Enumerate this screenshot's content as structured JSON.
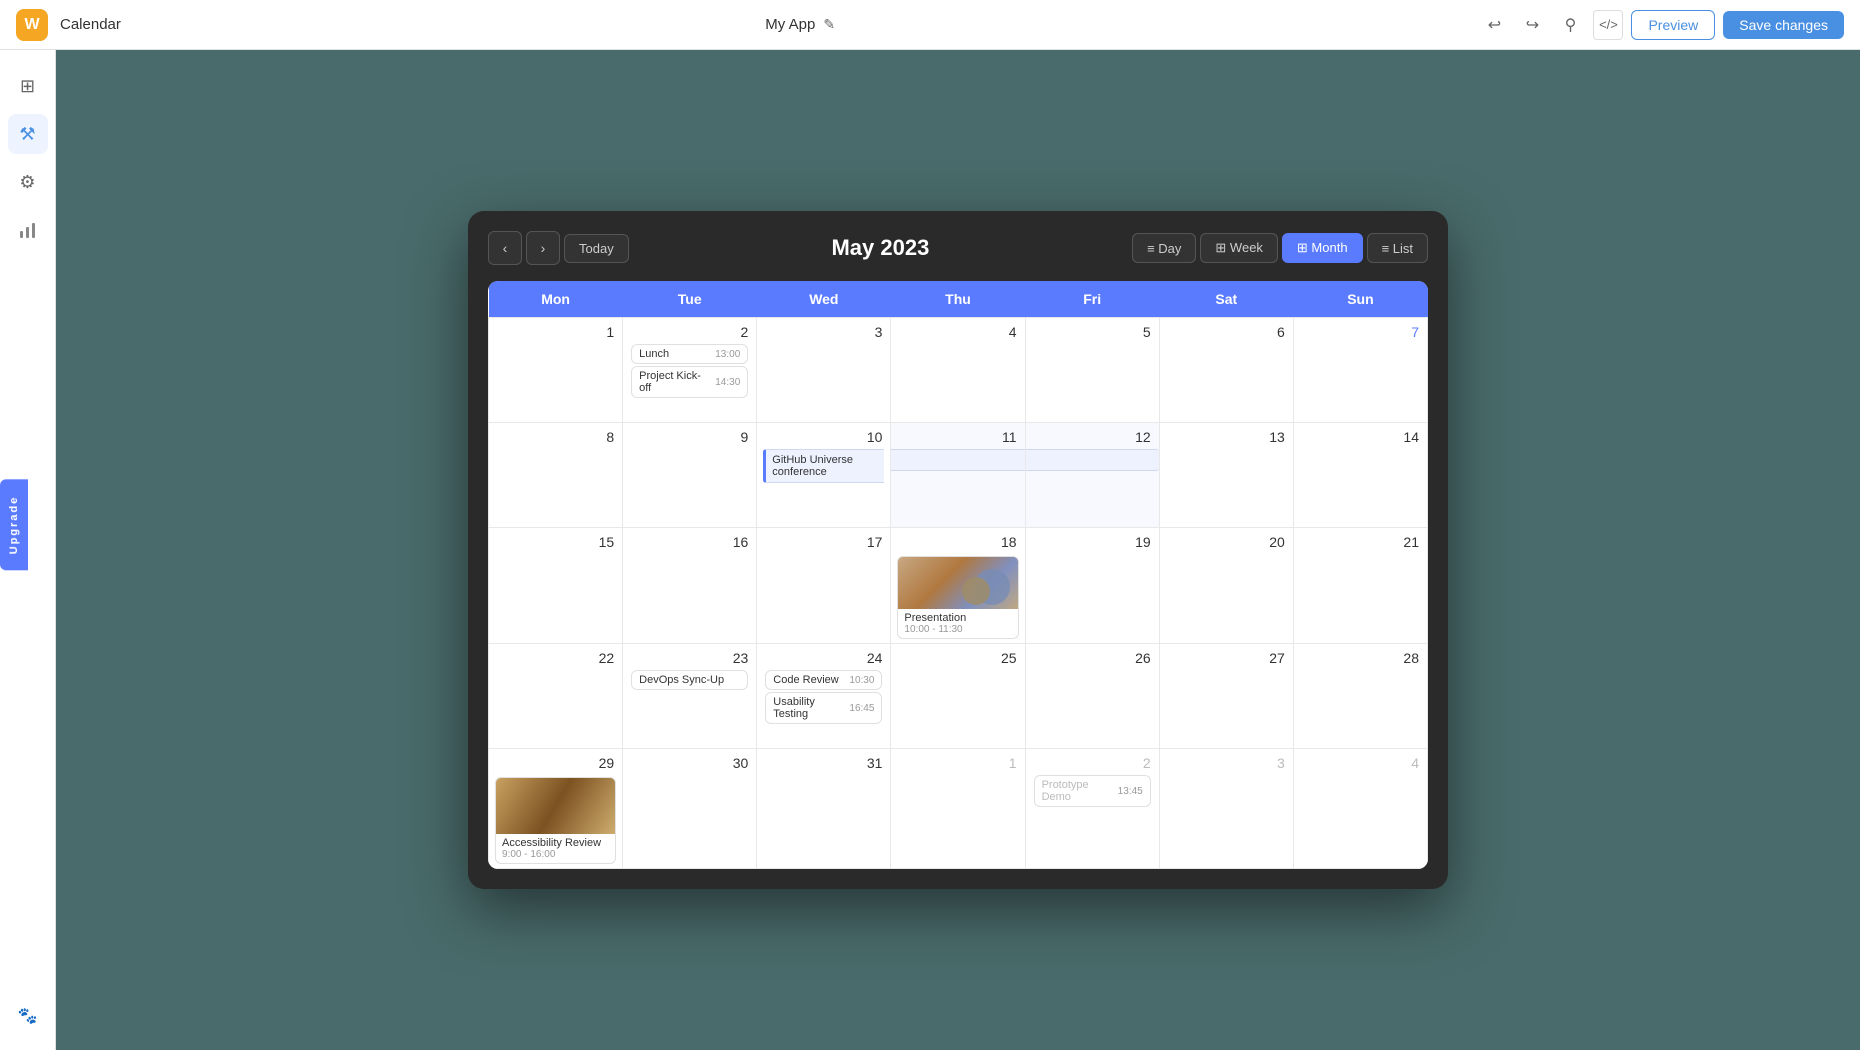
{
  "topbar": {
    "logo_text": "W",
    "title": "Calendar",
    "app_name": "My App",
    "edit_icon": "✎",
    "undo_icon": "↩",
    "redo_icon": "↪",
    "pin_icon": "⚲",
    "code_icon": "</>",
    "preview_label": "Preview",
    "save_label": "Save changes"
  },
  "sidebar": {
    "items": [
      {
        "icon": "⊞",
        "name": "dashboard",
        "active": false
      },
      {
        "icon": "⚒",
        "name": "tools",
        "active": true
      },
      {
        "icon": "⚙",
        "name": "settings",
        "active": false
      },
      {
        "icon": "📊",
        "name": "analytics",
        "active": false
      }
    ],
    "footer_icon": "🐾",
    "upgrade_label": "Upgrade"
  },
  "calendar": {
    "title": "May 2023",
    "nav": {
      "prev_label": "‹",
      "next_label": "›",
      "today_label": "Today"
    },
    "views": [
      {
        "label": "Day",
        "icon": "≡",
        "active": false
      },
      {
        "label": "Week",
        "icon": "⊞",
        "active": false
      },
      {
        "label": "Month",
        "icon": "⊞",
        "active": true
      },
      {
        "label": "List",
        "icon": "≡",
        "active": false
      }
    ],
    "weekdays": [
      "Mon",
      "Tue",
      "Wed",
      "Thu",
      "Fri",
      "Sat",
      "Sun"
    ],
    "weeks": [
      {
        "days": [
          {
            "num": "1",
            "other": false,
            "sunday": false,
            "events": []
          },
          {
            "num": "2",
            "other": false,
            "sunday": false,
            "events": [
              {
                "type": "simple",
                "title": "Lunch",
                "time": "13:00"
              },
              {
                "type": "simple",
                "title": "Project Kick-off",
                "time": "14:30"
              }
            ]
          },
          {
            "num": "3",
            "other": false,
            "sunday": false,
            "events": []
          },
          {
            "num": "4",
            "other": false,
            "sunday": false,
            "events": []
          },
          {
            "num": "5",
            "other": false,
            "sunday": false,
            "events": []
          },
          {
            "num": "6",
            "other": false,
            "sunday": false,
            "events": []
          },
          {
            "num": "7",
            "other": false,
            "sunday": true,
            "events": []
          }
        ]
      },
      {
        "days": [
          {
            "num": "8",
            "other": false,
            "sunday": false,
            "events": []
          },
          {
            "num": "9",
            "other": false,
            "sunday": false,
            "events": []
          },
          {
            "num": "10",
            "other": false,
            "sunday": false,
            "events": [
              {
                "type": "spanning",
                "title": "GitHub Universe conference"
              }
            ]
          },
          {
            "num": "11",
            "other": false,
            "sunday": false,
            "events": [
              {
                "type": "spanning-cont",
                "title": ""
              }
            ]
          },
          {
            "num": "12",
            "other": false,
            "sunday": false,
            "events": [
              {
                "type": "spanning-cont",
                "title": ""
              }
            ]
          },
          {
            "num": "13",
            "other": false,
            "sunday": false,
            "events": []
          },
          {
            "num": "14",
            "other": false,
            "sunday": false,
            "events": []
          }
        ]
      },
      {
        "days": [
          {
            "num": "15",
            "other": false,
            "sunday": false,
            "events": []
          },
          {
            "num": "16",
            "other": false,
            "sunday": false,
            "events": []
          },
          {
            "num": "17",
            "other": false,
            "sunday": false,
            "events": []
          },
          {
            "num": "18",
            "other": false,
            "sunday": false,
            "events": [
              {
                "type": "image-event",
                "title": "Presentation",
                "time": "10:00 - 11:30"
              }
            ]
          },
          {
            "num": "19",
            "other": false,
            "sunday": false,
            "events": []
          },
          {
            "num": "20",
            "other": false,
            "sunday": false,
            "events": []
          },
          {
            "num": "21",
            "other": false,
            "sunday": false,
            "events": []
          }
        ]
      },
      {
        "days": [
          {
            "num": "22",
            "other": false,
            "sunday": false,
            "events": []
          },
          {
            "num": "23",
            "other": false,
            "sunday": false,
            "events": [
              {
                "type": "simple",
                "title": "DevOps Sync-Up",
                "time": ""
              }
            ]
          },
          {
            "num": "24",
            "other": false,
            "sunday": false,
            "events": [
              {
                "type": "simple",
                "title": "Code Review",
                "time": "10:30"
              },
              {
                "type": "simple",
                "title": "Usability Testing",
                "time": "16:45"
              }
            ]
          },
          {
            "num": "25",
            "other": false,
            "sunday": false,
            "events": []
          },
          {
            "num": "26",
            "other": false,
            "sunday": false,
            "events": []
          },
          {
            "num": "27",
            "other": false,
            "sunday": false,
            "events": []
          },
          {
            "num": "28",
            "other": false,
            "sunday": false,
            "events": []
          }
        ]
      },
      {
        "days": [
          {
            "num": "29",
            "other": false,
            "sunday": false,
            "events": [
              {
                "type": "photo-event",
                "title": "Accessibility Review",
                "time": "9:00 - 16:00"
              }
            ]
          },
          {
            "num": "30",
            "other": false,
            "sunday": false,
            "events": []
          },
          {
            "num": "31",
            "other": false,
            "sunday": false,
            "events": []
          },
          {
            "num": "1",
            "other": true,
            "sunday": false,
            "events": []
          },
          {
            "num": "2",
            "other": true,
            "sunday": false,
            "events": [
              {
                "type": "simple",
                "title": "Prototype Demo",
                "time": "13:45"
              }
            ]
          },
          {
            "num": "3",
            "other": true,
            "sunday": false,
            "events": []
          },
          {
            "num": "4",
            "other": true,
            "sunday": false,
            "events": []
          }
        ]
      }
    ]
  }
}
